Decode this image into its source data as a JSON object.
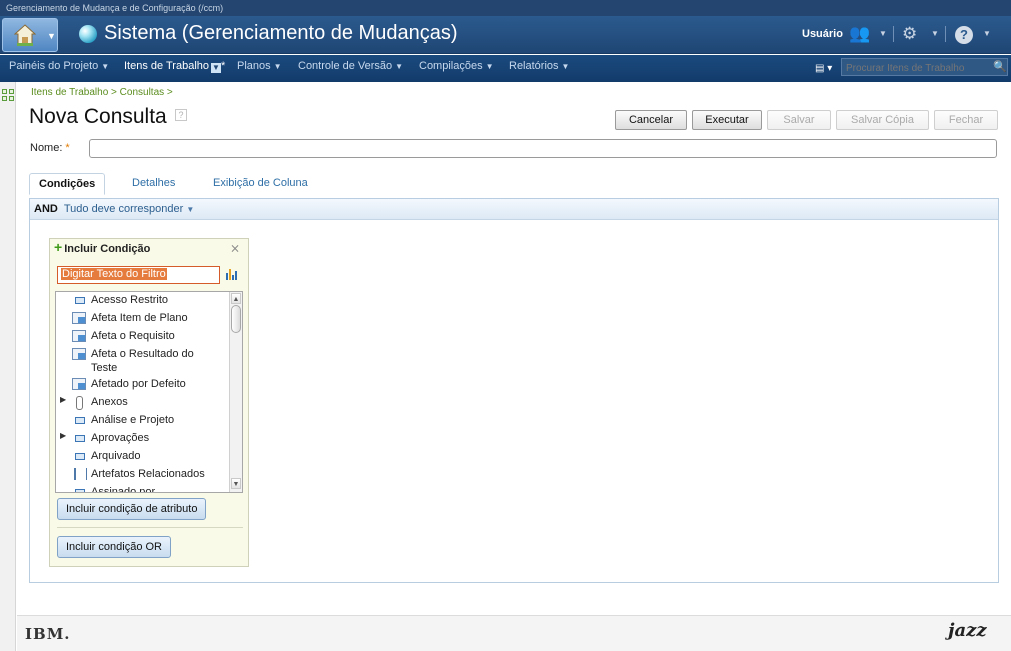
{
  "window": {
    "title": "Gerenciamento de Mudança e de Configuração (/ccm)"
  },
  "banner": {
    "app_title": "Sistema (Gerenciamento de Mudanças)",
    "user_label": "Usuário"
  },
  "nav": {
    "items": [
      {
        "label": "Painéis do Projeto"
      },
      {
        "label": "Itens de Trabalho"
      },
      {
        "label": "Planos"
      },
      {
        "label": "Controle de Versão"
      },
      {
        "label": "Compilações"
      },
      {
        "label": "Relatórios"
      }
    ],
    "active_marker": "*",
    "search_placeholder": "Procurar Itens de Trabalho"
  },
  "breadcrumb": "Itens de Trabalho > Consultas >",
  "page": {
    "title": "Nova Consulta",
    "help": "?"
  },
  "actions": {
    "cancel": "Cancelar",
    "run": "Executar",
    "save": "Salvar",
    "save_copy": "Salvar Cópia",
    "close": "Fechar"
  },
  "form": {
    "name_label": "Nome:",
    "required_mark": "*",
    "name_value": ""
  },
  "tabs": [
    {
      "label": "Condições"
    },
    {
      "label": "Detalhes"
    },
    {
      "label": "Exibição de Coluna"
    }
  ],
  "conditions": {
    "operator": "AND",
    "match_label": "Tudo deve corresponder"
  },
  "add_condition": {
    "title": "Incluir Condição",
    "filter_placeholder": "Digitar Texto do Filtro",
    "items": [
      {
        "label": "Acesso Restrito"
      },
      {
        "label": "Afeta Item de Plano"
      },
      {
        "label": "Afeta o Requisito"
      },
      {
        "label": "Afeta o Resultado do Teste"
      },
      {
        "label": "Afetado por Defeito"
      },
      {
        "label": "Anexos"
      },
      {
        "label": "Análise e Projeto"
      },
      {
        "label": "Aprovações"
      },
      {
        "label": "Arquivado"
      },
      {
        "label": "Artefatos Relacionados"
      },
      {
        "label": "Assinado por"
      }
    ],
    "add_attribute_button": "Incluir condição de atributo",
    "add_or_button": "Incluir condição OR"
  },
  "footer": {
    "ibm": "IBM.",
    "jazz": "jazz"
  }
}
